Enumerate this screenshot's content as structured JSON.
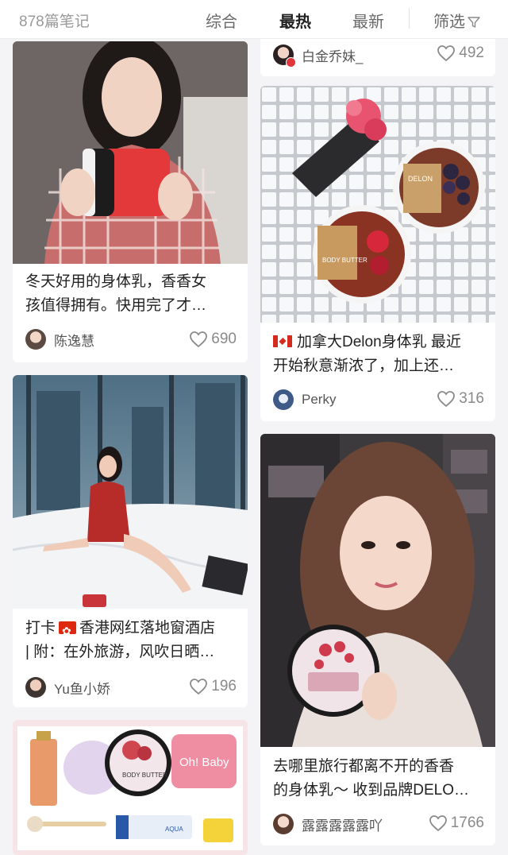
{
  "filter_bar": {
    "count": "878篇笔记",
    "tabs": [
      "综合",
      "最热",
      "最新"
    ],
    "active_tab": "最热",
    "filter_label": "筛选",
    "filter_icon": "funnel-icon"
  },
  "left_column": [
    {
      "title_line1": "冬天好用的身体乳，香香女",
      "title_line2": "孩值得拥有。快用完了才…",
      "author": "陈逸慧",
      "likes": "690"
    },
    {
      "title_prefix": "打卡",
      "title_line1_rest": "香港网红落地窗酒店",
      "title_line2": "| 附：在外旅游，风吹日晒…",
      "author": "Yu鱼小娇",
      "likes": "196",
      "flag": "hong-kong-flag-icon"
    },
    {
      "product_labels": [
        "BODY BUTTER",
        "Oh! Baby",
        "AQUA"
      ]
    }
  ],
  "right_column": [
    {
      "author": "白金乔妹_",
      "likes": "492"
    },
    {
      "title_line1": "加拿大Delon身体乳 最近",
      "title_line2": "开始秋意渐浓了，加上还…",
      "author": "Perky",
      "likes": "316",
      "flag": "canada-flag-icon",
      "image_labels": [
        "DELON",
        "BODY BUTTER"
      ]
    },
    {
      "title_line1": "去哪里旅行都离不开的香香",
      "title_line2": "的身体乳～ 收到品牌DELO…",
      "author": "露露露露露吖",
      "likes": "1766"
    }
  ],
  "colors": {
    "background": "#f4f4f6",
    "card": "#ffffff",
    "active_tab": "#222222",
    "muted": "#8a8a8a"
  }
}
